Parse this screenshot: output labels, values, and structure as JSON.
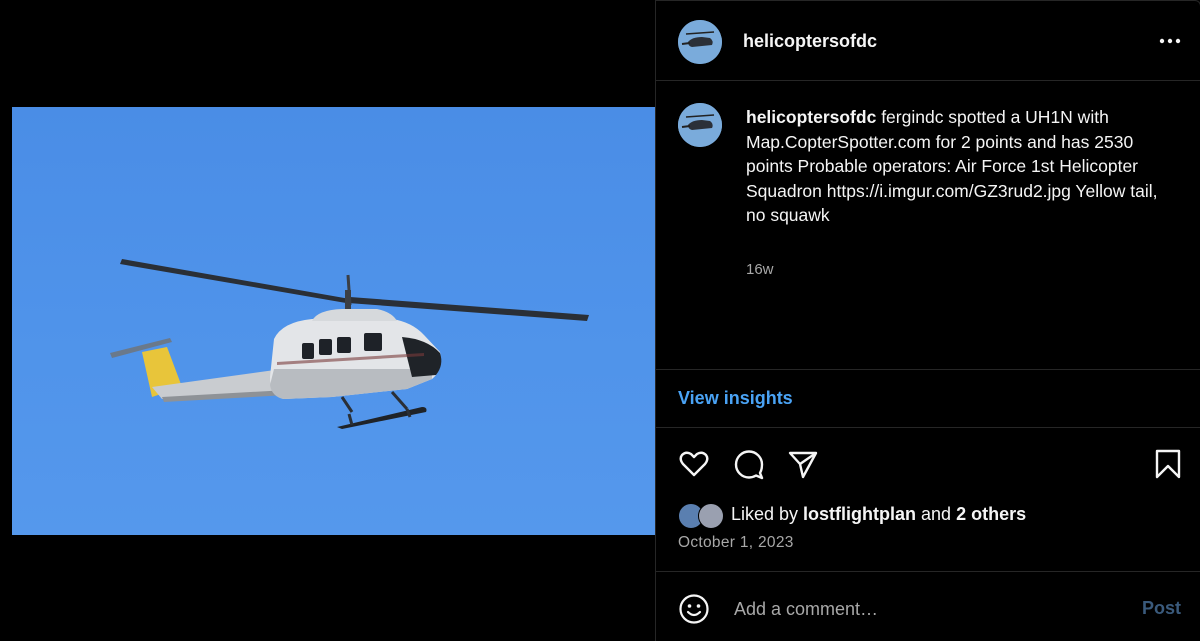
{
  "post": {
    "username": "helicoptersofdc",
    "avatar_icon": "helicopter-avatar-icon",
    "more_icon": "more-options-icon",
    "caption_user": "helicoptersofdc",
    "caption_text": "fergindc spotted a UH1N with Map.CopterSpotter.com for 2 points and has 2530 points Probable operators: Air Force 1st Helicopter Squadron https://i.imgur.com/GZ3rud2.jpg Yellow tail, no squawk",
    "time_ago": "16w",
    "insights_label": "View insights",
    "likes": {
      "prefix": "Liked by ",
      "user": "lostflightplan",
      "middle": " and ",
      "others": "2 others"
    },
    "date": "October 1, 2023",
    "comment_placeholder": "Add a comment…",
    "post_label": "Post"
  },
  "colors": {
    "background": "#000000",
    "link_blue": "#4aa3f5",
    "post_disabled": "#3a5a7c",
    "muted_text": "#a8a8a8",
    "sky": "#4f93ea",
    "tail_yellow": "#e8c53a"
  },
  "icons": {
    "like": "heart-icon",
    "comment": "comment-bubble-icon",
    "share": "send-paper-plane-icon",
    "save": "bookmark-icon",
    "emoji": "smiley-emoji-icon"
  }
}
